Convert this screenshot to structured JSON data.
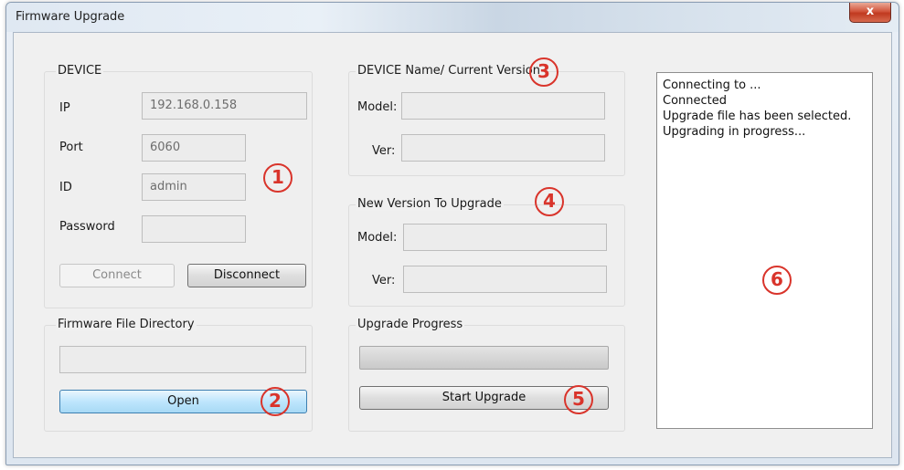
{
  "window": {
    "title": "Firmware Upgrade",
    "close_glyph": "x"
  },
  "device": {
    "group_label": "DEVICE",
    "ip_label": "IP",
    "ip_value": "192.168.0.158",
    "port_label": "Port",
    "port_value": "6060",
    "id_label": "ID",
    "id_value": "admin",
    "password_label": "Password",
    "password_value": "",
    "connect_label": "Connect",
    "disconnect_label": "Disconnect"
  },
  "firmware_dir": {
    "group_label": "Firmware File Directory",
    "path_value": "",
    "open_label": "Open"
  },
  "current_version": {
    "group_label": "DEVICE Name/ Current Version",
    "model_label": "Model:",
    "model_value": "",
    "ver_label": "Ver:",
    "ver_value": ""
  },
  "new_version": {
    "group_label": "New Version To Upgrade",
    "model_label": "Model:",
    "model_value": "",
    "ver_label": "Ver:",
    "ver_value": ""
  },
  "upgrade": {
    "group_label": "Upgrade Progress",
    "progress_fraction": 0,
    "start_label": "Start Upgrade"
  },
  "log": {
    "lines": [
      "Connecting to ...",
      "Connected",
      "Upgrade file has been selected.",
      "Upgrading in progress..."
    ]
  },
  "annotations": [
    "1",
    "2",
    "3",
    "4",
    "5",
    "6"
  ],
  "colors": {
    "annotation": "#d9342b",
    "open_button": "#bee6fd",
    "close_button": "#c0391f"
  }
}
